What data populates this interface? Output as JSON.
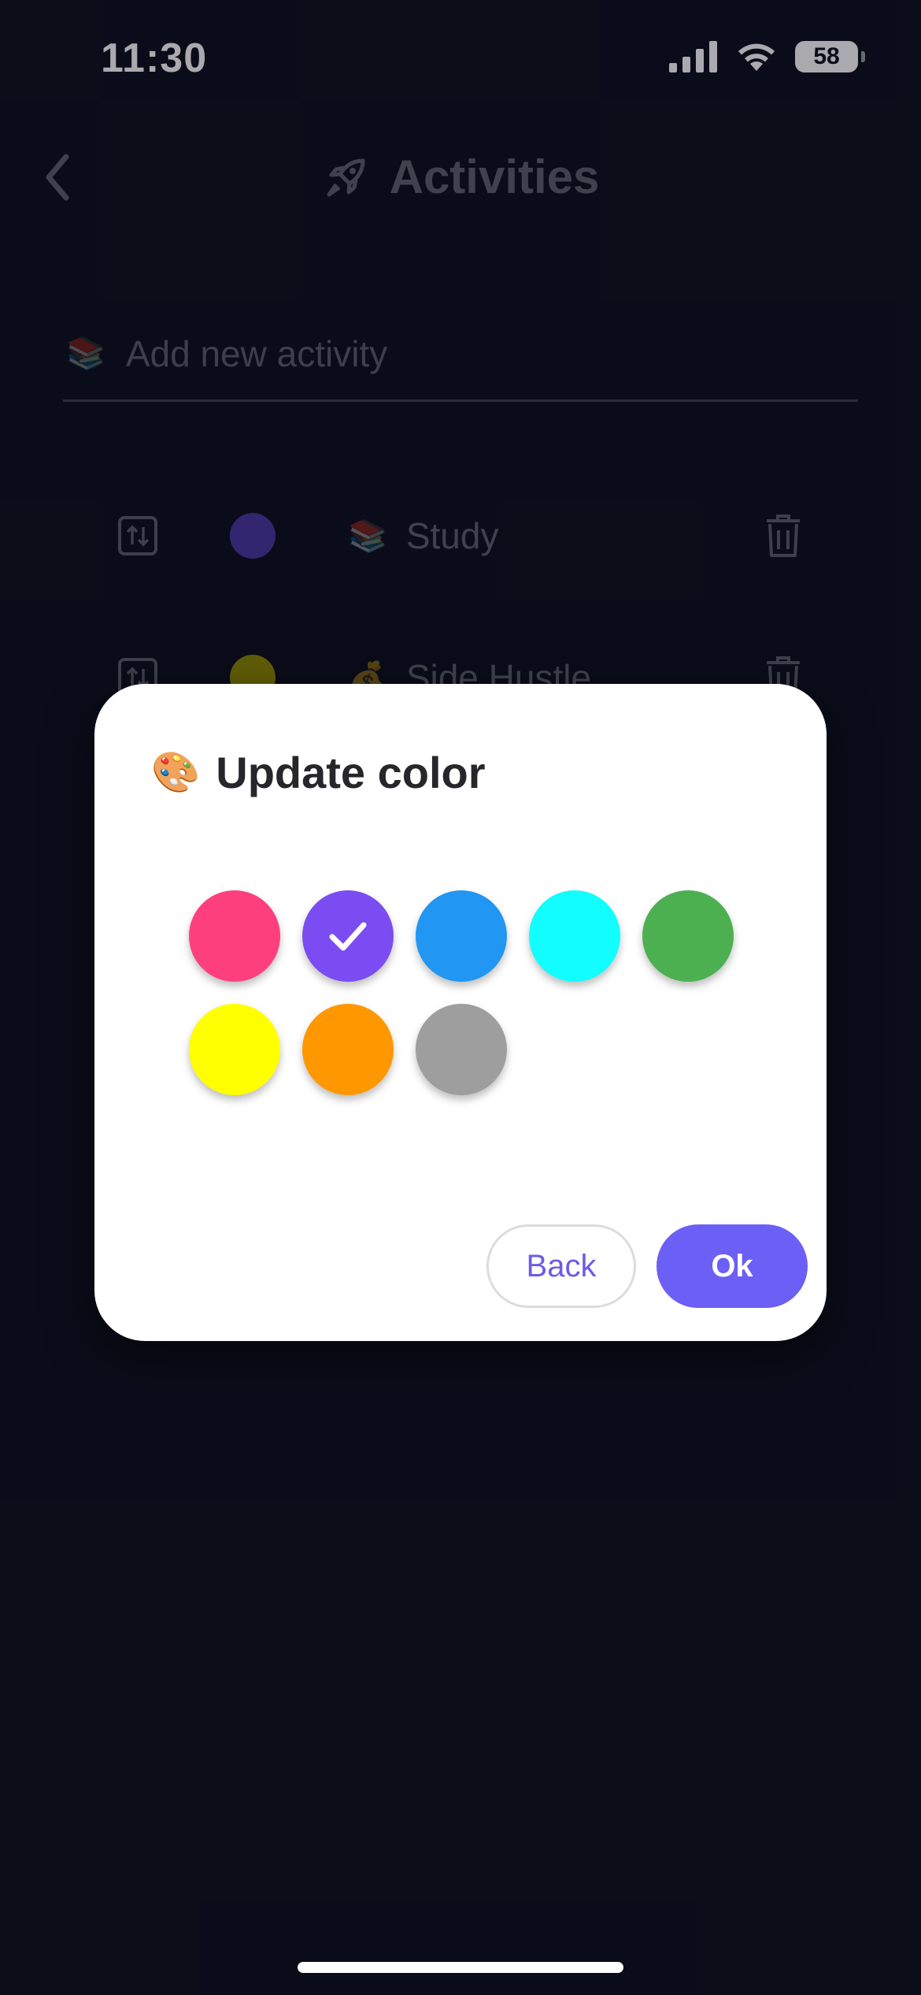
{
  "status_bar": {
    "time": "11:30",
    "battery": "58"
  },
  "header": {
    "title": "Activities",
    "back_icon": "chevron-left-icon",
    "title_icon": "rocket-icon"
  },
  "add_activity": {
    "emoji": "📚",
    "placeholder": "Add new activity"
  },
  "activities": [
    {
      "emoji": "📚",
      "name": "Study",
      "color": "#4a37a0"
    },
    {
      "emoji": "💰",
      "name": "Side Hustle",
      "color": "#8f8a00"
    }
  ],
  "dialog": {
    "emoji": "🎨",
    "title": "Update color",
    "selected_index": 1,
    "colors": [
      "#fe3f7e",
      "#7a4cf2",
      "#2196f3",
      "#12fdfd",
      "#4caf50",
      "#ffff00",
      "#ff9800",
      "#9e9e9e"
    ],
    "back_label": "Back",
    "ok_label": "Ok"
  }
}
